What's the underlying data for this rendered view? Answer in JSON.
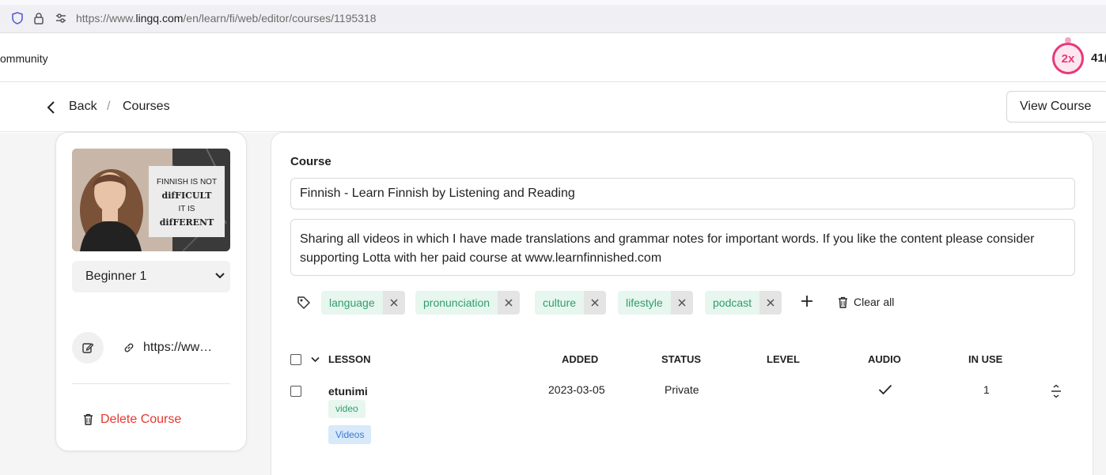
{
  "browser": {
    "url_prefix": "https://www.",
    "url_host": "lingq.com",
    "url_path": "/en/learn/fi/web/editor/courses/1195318"
  },
  "header": {
    "nav_community": "ommunity",
    "streak_multiplier": "2x",
    "count_partial": "41("
  },
  "breadcrumb": {
    "back_label": "Back",
    "separator": "/",
    "current": "Courses",
    "view_course_label": "View Course"
  },
  "sidebar": {
    "cover_text": [
      "FINNISH IS NOT",
      "difFICULT",
      "IT IS",
      "difFERENT"
    ],
    "level_value": "Beginner 1",
    "link_text": "https://www.lingq.com",
    "delete_label": "Delete Course"
  },
  "course": {
    "section_label": "Course",
    "title_value": "Finnish - Learn Finnish by Listening and Reading",
    "description": "Sharing all videos in which I have made translations and grammar notes for important words. If you like the content please consider supporting Lotta with her paid course at www.learnfinnished.com",
    "tags": [
      "language",
      "pronunciation",
      "culture",
      "lifestyle",
      "podcast"
    ],
    "clear_all_label": "Clear all"
  },
  "lessons_table": {
    "columns": [
      "LESSON",
      "ADDED",
      "STATUS",
      "LEVEL",
      "AUDIO",
      "IN USE"
    ],
    "rows": [
      {
        "title": "etunimi",
        "tags": [
          "video",
          "Videos"
        ],
        "added": "2023-03-05",
        "status": "Private",
        "level": "",
        "audio_icon": "check-icon",
        "in_use": "1"
      }
    ]
  },
  "colors": {
    "accent_pink": "#e8387a",
    "tag_green": "#2f9e6e",
    "tag_bg": "#e7f6ee",
    "delete_red": "#e4382f",
    "chip_blue": "#3b7ad1"
  },
  "icons": [
    "shield-icon",
    "lock-icon",
    "site-permissions-icon",
    "chevron-left-icon",
    "chevron-down-icon",
    "edit-icon",
    "link-icon",
    "trash-icon",
    "tag-icon",
    "close-icon",
    "plus-icon",
    "check-icon",
    "row-menu-icon"
  ]
}
